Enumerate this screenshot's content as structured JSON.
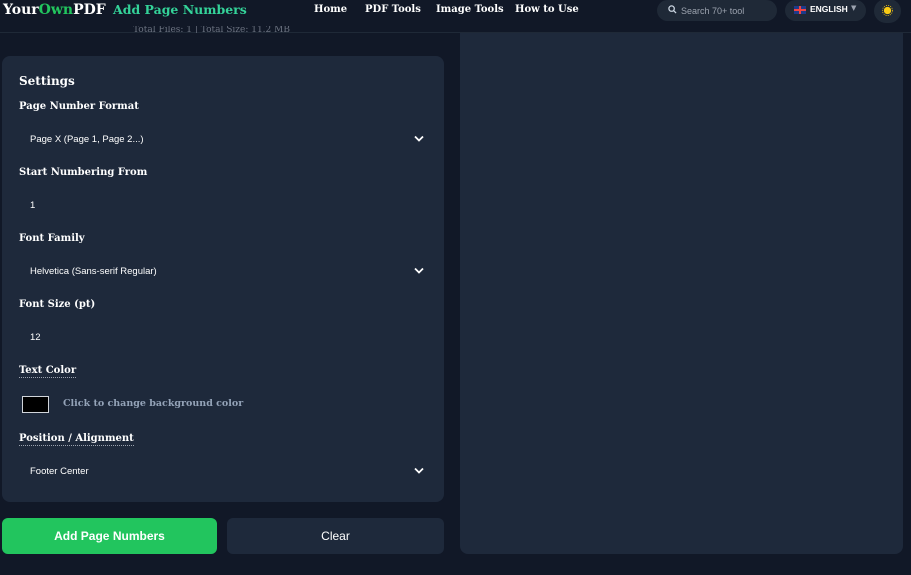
{
  "header": {
    "logo": {
      "part1": "Your",
      "part2": "Own",
      "part3": "PDF"
    },
    "page_name": "Add Page Numbers",
    "nav": [
      "Home",
      "PDF Tools",
      "Image Tools",
      "How to Use"
    ],
    "search_placeholder": "Search 70+ tool",
    "language": "ENGLISH",
    "icons": {
      "search": "search-icon",
      "flag": "uk-flag-icon",
      "caret": "caret-down-icon",
      "theme": "sun-icon"
    }
  },
  "stats": "Total Files: 1  |  Total Size: 11.2 MB",
  "settings": {
    "title": "Settings",
    "page_number_format": {
      "label": "Page Number Format",
      "value": "Page X (Page 1, Page 2...)"
    },
    "start_numbering": {
      "label": "Start Numbering From",
      "value": "1"
    },
    "font_family": {
      "label": "Font Family",
      "value": "Helvetica (Sans-serif Regular)"
    },
    "font_size": {
      "label": "Font Size (pt)",
      "value": "12"
    },
    "text_color": {
      "label": "Text Color",
      "value": "#000000",
      "hint": "Click to change background color"
    },
    "position": {
      "label": "Position / Alignment",
      "value": "Footer Center"
    }
  },
  "actions": {
    "primary": "Add Page Numbers",
    "secondary": "Clear"
  },
  "colors": {
    "accent": "#22c55e",
    "background": "#111827",
    "panel": "#1e293b"
  }
}
